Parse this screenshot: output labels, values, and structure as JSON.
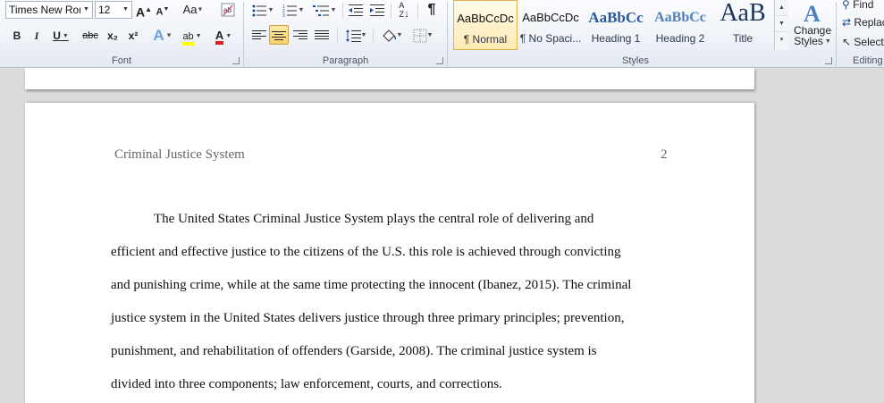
{
  "font_group": {
    "font_name": "Times New Rom",
    "font_size": "12",
    "grow_label": "A",
    "shrink_label": "A",
    "change_case_label": "Aa",
    "clear_formatting_icon": "clear-formatting-icon",
    "bold": "B",
    "italic": "I",
    "underline": "U",
    "strikethrough": "abc",
    "subscript": "x₂",
    "superscript": "x²",
    "text_effects": "A",
    "highlight": "ab",
    "font_color": "A",
    "label": "Font",
    "highlight_color": "#ffff00",
    "font_color_value": "#e31b1b"
  },
  "paragraph_group": {
    "label": "Paragraph",
    "show_marks": "¶",
    "sort_label": "A↓Z"
  },
  "styles_group": {
    "label": "Styles",
    "tiles": [
      {
        "sample": "AaBbCcDc",
        "name": "¶ Normal",
        "selected": true
      },
      {
        "sample": "AaBbCcDc",
        "name": "¶ No Spaci..."
      },
      {
        "sample": "AaBbCc",
        "name": "Heading 1"
      },
      {
        "sample": "AaBbCc",
        "name": "Heading 2"
      },
      {
        "sample": "AaB",
        "name": "Title"
      }
    ],
    "change_styles": "Change Styles",
    "heading_color": "#2a5a9a"
  },
  "editing_group": {
    "label": "Editing",
    "find": "Find",
    "replace": "Replace",
    "select": "Select"
  },
  "document": {
    "running_head": "Criminal Justice System",
    "page_number": "2",
    "lines": [
      "The United States Criminal Justice System plays the central role of delivering and",
      "efficient and effective justice to the citizens of the U.S. this role is achieved through convicting",
      "and punishing crime, while at the same time protecting the innocent (Ibanez, 2015). The criminal",
      "justice system in the United States delivers justice through three primary principles; prevention,",
      "punishment, and rehabilitation of offenders (Garside, 2008). The criminal justice system is",
      "divided into three components; law enforcement, courts, and corrections."
    ]
  }
}
